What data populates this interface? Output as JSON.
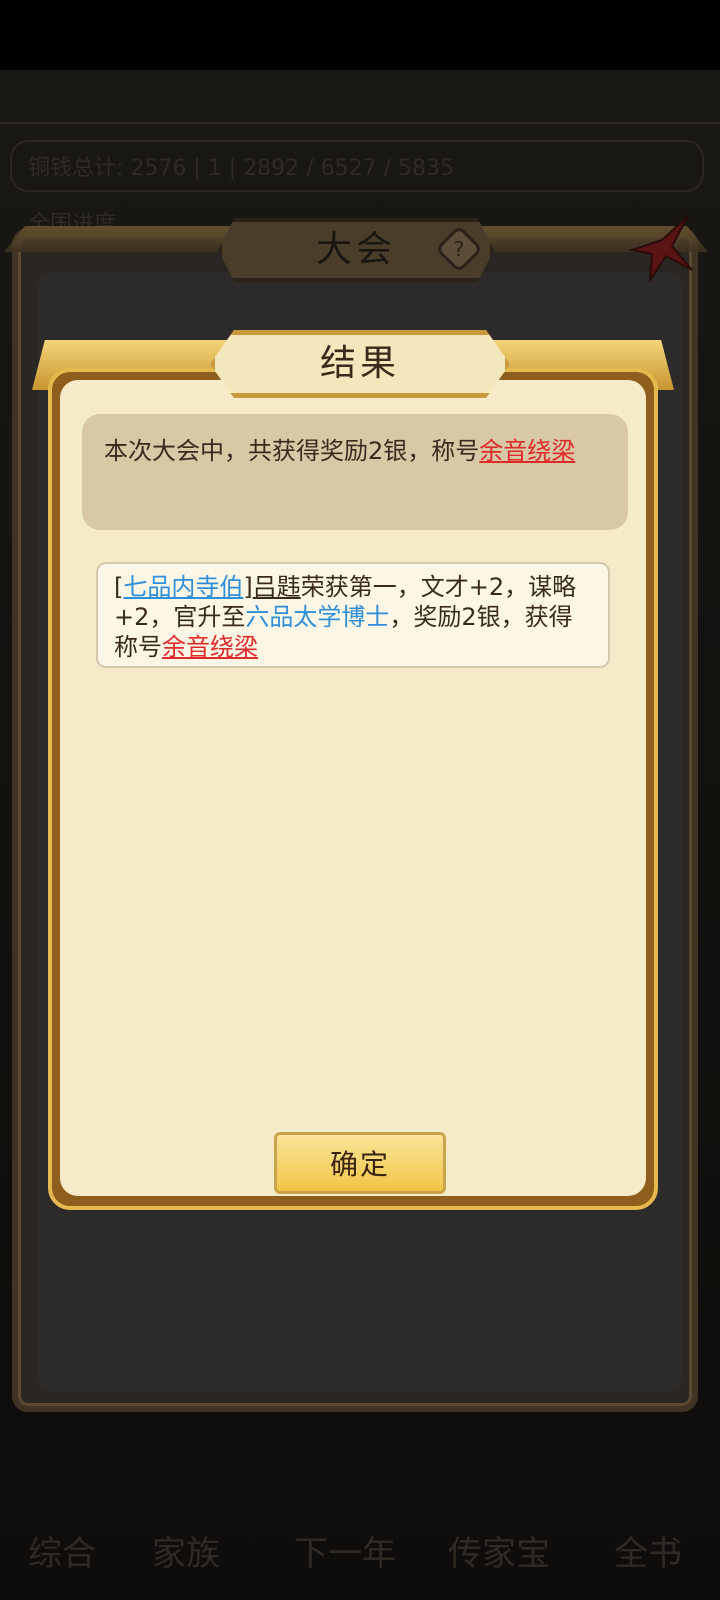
{
  "background": {
    "top_info": "铜钱总计: 2576 | 1 | 2892 / 6527 / 5835",
    "sub_info": "全国进度",
    "bottom_nav": [
      "综合",
      "家族",
      "下一年",
      "传家宝",
      "全书"
    ]
  },
  "outer_dialog": {
    "title": "大会",
    "help_glyph": "?"
  },
  "result_dialog": {
    "title": "结果",
    "summary": {
      "text": "本次大会中，共获得奖励2银，称号",
      "honor": "余音绕梁"
    },
    "log": {
      "bracket_open": "[",
      "rank": "七品内寺伯",
      "bracket_close": "]",
      "name": "吕韪",
      "text1": "荣获第一，文才+2，谋略+2，官升至",
      "new_rank": "六品太学博士",
      "text2": "，奖励2银，获得称号",
      "honor": "余音绕梁"
    },
    "confirm_label": "确定"
  },
  "colors": {
    "red_link": "#e02b2b",
    "blue_link": "#2f8fd8",
    "panel": "#f6ebc9",
    "gold": "#e6b94e"
  }
}
